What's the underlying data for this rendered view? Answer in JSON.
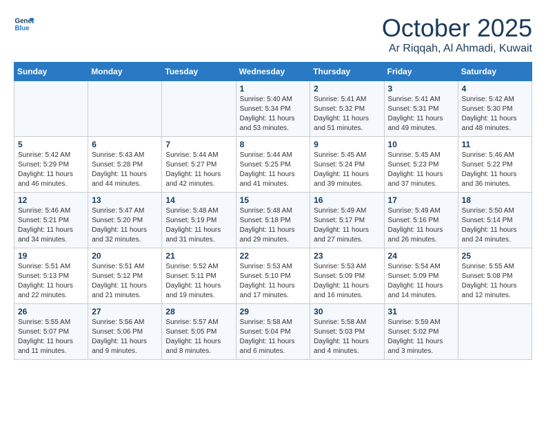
{
  "logo": {
    "line1": "General",
    "line2": "Blue"
  },
  "header": {
    "month": "October 2025",
    "location": "Ar Riqqah, Al Ahmadi, Kuwait"
  },
  "weekdays": [
    "Sunday",
    "Monday",
    "Tuesday",
    "Wednesday",
    "Thursday",
    "Friday",
    "Saturday"
  ],
  "weeks": [
    [
      {
        "day": "",
        "sunrise": "",
        "sunset": "",
        "daylight": ""
      },
      {
        "day": "",
        "sunrise": "",
        "sunset": "",
        "daylight": ""
      },
      {
        "day": "",
        "sunrise": "",
        "sunset": "",
        "daylight": ""
      },
      {
        "day": "1",
        "sunrise": "Sunrise: 5:40 AM",
        "sunset": "Sunset: 5:34 PM",
        "daylight": "Daylight: 11 hours and 53 minutes."
      },
      {
        "day": "2",
        "sunrise": "Sunrise: 5:41 AM",
        "sunset": "Sunset: 5:32 PM",
        "daylight": "Daylight: 11 hours and 51 minutes."
      },
      {
        "day": "3",
        "sunrise": "Sunrise: 5:41 AM",
        "sunset": "Sunset: 5:31 PM",
        "daylight": "Daylight: 11 hours and 49 minutes."
      },
      {
        "day": "4",
        "sunrise": "Sunrise: 5:42 AM",
        "sunset": "Sunset: 5:30 PM",
        "daylight": "Daylight: 11 hours and 48 minutes."
      }
    ],
    [
      {
        "day": "5",
        "sunrise": "Sunrise: 5:42 AM",
        "sunset": "Sunset: 5:29 PM",
        "daylight": "Daylight: 11 hours and 46 minutes."
      },
      {
        "day": "6",
        "sunrise": "Sunrise: 5:43 AM",
        "sunset": "Sunset: 5:28 PM",
        "daylight": "Daylight: 11 hours and 44 minutes."
      },
      {
        "day": "7",
        "sunrise": "Sunrise: 5:44 AM",
        "sunset": "Sunset: 5:27 PM",
        "daylight": "Daylight: 11 hours and 42 minutes."
      },
      {
        "day": "8",
        "sunrise": "Sunrise: 5:44 AM",
        "sunset": "Sunset: 5:25 PM",
        "daylight": "Daylight: 11 hours and 41 minutes."
      },
      {
        "day": "9",
        "sunrise": "Sunrise: 5:45 AM",
        "sunset": "Sunset: 5:24 PM",
        "daylight": "Daylight: 11 hours and 39 minutes."
      },
      {
        "day": "10",
        "sunrise": "Sunrise: 5:45 AM",
        "sunset": "Sunset: 5:23 PM",
        "daylight": "Daylight: 11 hours and 37 minutes."
      },
      {
        "day": "11",
        "sunrise": "Sunrise: 5:46 AM",
        "sunset": "Sunset: 5:22 PM",
        "daylight": "Daylight: 11 hours and 36 minutes."
      }
    ],
    [
      {
        "day": "12",
        "sunrise": "Sunrise: 5:46 AM",
        "sunset": "Sunset: 5:21 PM",
        "daylight": "Daylight: 11 hours and 34 minutes."
      },
      {
        "day": "13",
        "sunrise": "Sunrise: 5:47 AM",
        "sunset": "Sunset: 5:20 PM",
        "daylight": "Daylight: 11 hours and 32 minutes."
      },
      {
        "day": "14",
        "sunrise": "Sunrise: 5:48 AM",
        "sunset": "Sunset: 5:19 PM",
        "daylight": "Daylight: 11 hours and 31 minutes."
      },
      {
        "day": "15",
        "sunrise": "Sunrise: 5:48 AM",
        "sunset": "Sunset: 5:18 PM",
        "daylight": "Daylight: 11 hours and 29 minutes."
      },
      {
        "day": "16",
        "sunrise": "Sunrise: 5:49 AM",
        "sunset": "Sunset: 5:17 PM",
        "daylight": "Daylight: 11 hours and 27 minutes."
      },
      {
        "day": "17",
        "sunrise": "Sunrise: 5:49 AM",
        "sunset": "Sunset: 5:16 PM",
        "daylight": "Daylight: 11 hours and 26 minutes."
      },
      {
        "day": "18",
        "sunrise": "Sunrise: 5:50 AM",
        "sunset": "Sunset: 5:14 PM",
        "daylight": "Daylight: 11 hours and 24 minutes."
      }
    ],
    [
      {
        "day": "19",
        "sunrise": "Sunrise: 5:51 AM",
        "sunset": "Sunset: 5:13 PM",
        "daylight": "Daylight: 11 hours and 22 minutes."
      },
      {
        "day": "20",
        "sunrise": "Sunrise: 5:51 AM",
        "sunset": "Sunset: 5:12 PM",
        "daylight": "Daylight: 11 hours and 21 minutes."
      },
      {
        "day": "21",
        "sunrise": "Sunrise: 5:52 AM",
        "sunset": "Sunset: 5:11 PM",
        "daylight": "Daylight: 11 hours and 19 minutes."
      },
      {
        "day": "22",
        "sunrise": "Sunrise: 5:53 AM",
        "sunset": "Sunset: 5:10 PM",
        "daylight": "Daylight: 11 hours and 17 minutes."
      },
      {
        "day": "23",
        "sunrise": "Sunrise: 5:53 AM",
        "sunset": "Sunset: 5:09 PM",
        "daylight": "Daylight: 11 hours and 16 minutes."
      },
      {
        "day": "24",
        "sunrise": "Sunrise: 5:54 AM",
        "sunset": "Sunset: 5:09 PM",
        "daylight": "Daylight: 11 hours and 14 minutes."
      },
      {
        "day": "25",
        "sunrise": "Sunrise: 5:55 AM",
        "sunset": "Sunset: 5:08 PM",
        "daylight": "Daylight: 11 hours and 12 minutes."
      }
    ],
    [
      {
        "day": "26",
        "sunrise": "Sunrise: 5:55 AM",
        "sunset": "Sunset: 5:07 PM",
        "daylight": "Daylight: 11 hours and 11 minutes."
      },
      {
        "day": "27",
        "sunrise": "Sunrise: 5:56 AM",
        "sunset": "Sunset: 5:06 PM",
        "daylight": "Daylight: 11 hours and 9 minutes."
      },
      {
        "day": "28",
        "sunrise": "Sunrise: 5:57 AM",
        "sunset": "Sunset: 5:05 PM",
        "daylight": "Daylight: 11 hours and 8 minutes."
      },
      {
        "day": "29",
        "sunrise": "Sunrise: 5:58 AM",
        "sunset": "Sunset: 5:04 PM",
        "daylight": "Daylight: 11 hours and 6 minutes."
      },
      {
        "day": "30",
        "sunrise": "Sunrise: 5:58 AM",
        "sunset": "Sunset: 5:03 PM",
        "daylight": "Daylight: 11 hours and 4 minutes."
      },
      {
        "day": "31",
        "sunrise": "Sunrise: 5:59 AM",
        "sunset": "Sunset: 5:02 PM",
        "daylight": "Daylight: 11 hours and 3 minutes."
      },
      {
        "day": "",
        "sunrise": "",
        "sunset": "",
        "daylight": ""
      }
    ]
  ]
}
